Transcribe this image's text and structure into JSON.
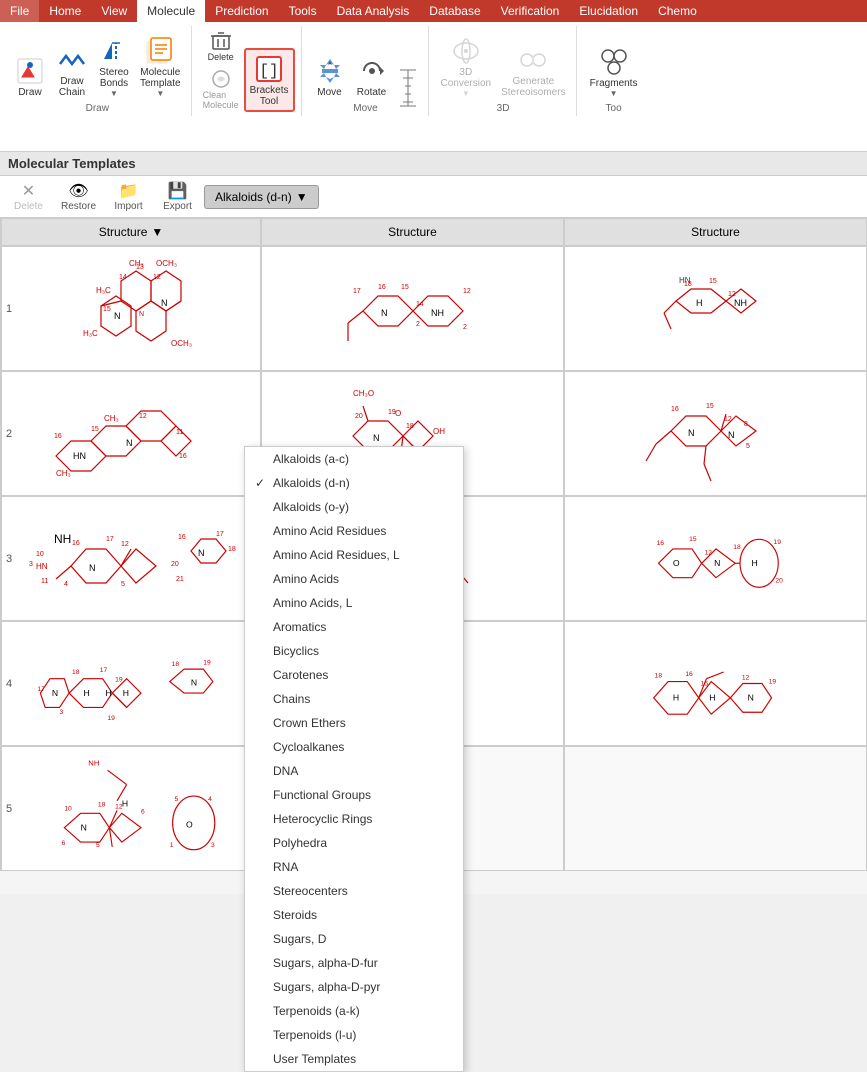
{
  "menuBar": {
    "items": [
      "File",
      "Home",
      "View",
      "Molecule",
      "Prediction",
      "Tools",
      "Data Analysis",
      "Database",
      "Verification",
      "Elucidation",
      "Chemo"
    ]
  },
  "ribbon": {
    "activeTab": "Molecule",
    "groups": [
      {
        "label": "Draw",
        "buttons": [
          {
            "id": "draw",
            "label": "Draw",
            "icon": "✏️"
          },
          {
            "id": "draw-chain",
            "label": "Draw\nChain",
            "icon": "chain"
          },
          {
            "id": "stereo-bonds",
            "label": "Stereo\nBonds",
            "icon": "stereo"
          },
          {
            "id": "molecule-template",
            "label": "Molecule\nTemplate",
            "icon": "📋"
          }
        ]
      },
      {
        "label": "",
        "buttons": [
          {
            "id": "delete",
            "label": "Delete",
            "icon": "delete"
          },
          {
            "id": "clean-molecule",
            "label": "Clean\nMolecule",
            "icon": "clean"
          },
          {
            "id": "brackets",
            "label": "Brackets\nTool",
            "icon": "brackets",
            "highlighted": true
          }
        ]
      },
      {
        "label": "Move",
        "buttons": [
          {
            "id": "move",
            "label": "Move",
            "icon": "move"
          },
          {
            "id": "rotate",
            "label": "Rotate",
            "icon": "rotate"
          },
          {
            "id": "scale",
            "label": "",
            "icon": "scale"
          }
        ]
      },
      {
        "label": "3D",
        "buttons": [
          {
            "id": "3d-conversion",
            "label": "3D\nConversion",
            "icon": "3d",
            "disabled": true
          },
          {
            "id": "generate-stereoisomers",
            "label": "Generate\nStereoisomers",
            "icon": "stereoiso",
            "disabled": true
          }
        ]
      },
      {
        "label": "Too",
        "buttons": [
          {
            "id": "fragments",
            "label": "Fragments",
            "icon": "fragments"
          }
        ]
      }
    ]
  },
  "toolbar": {
    "title": "Molecular Templates"
  },
  "actionBar": {
    "buttons": [
      {
        "id": "delete-btn",
        "label": "Delete",
        "icon": "✕",
        "disabled": false
      },
      {
        "id": "restore-btn",
        "label": "Restore",
        "icon": "👁",
        "disabled": false
      },
      {
        "id": "import-btn",
        "label": "Import",
        "icon": "📁",
        "disabled": false
      },
      {
        "id": "export-btn",
        "label": "Export",
        "icon": "💾",
        "disabled": false
      }
    ],
    "dropdown": {
      "label": "Alkaloids (d-n)",
      "active": true
    }
  },
  "grid": {
    "headers": [
      "Structure",
      "Structure",
      "Structure"
    ],
    "rows": [
      1,
      2,
      3,
      4,
      5
    ]
  },
  "dropdown": {
    "items": [
      {
        "label": "Alkaloids (a-c)",
        "checked": false
      },
      {
        "label": "Alkaloids (d-n)",
        "checked": true
      },
      {
        "label": "Alkaloids (o-y)",
        "checked": false
      },
      {
        "label": "Amino Acid Residues",
        "checked": false
      },
      {
        "label": "Amino Acid Residues, L",
        "checked": false
      },
      {
        "label": "Amino Acids",
        "checked": false
      },
      {
        "label": "Amino Acids, L",
        "checked": false
      },
      {
        "label": "Aromatics",
        "checked": false
      },
      {
        "label": "Bicyclics",
        "checked": false
      },
      {
        "label": "Carotenes",
        "checked": false
      },
      {
        "label": "Chains",
        "checked": false
      },
      {
        "label": "Crown Ethers",
        "checked": false
      },
      {
        "label": "Cycloalkanes",
        "checked": false
      },
      {
        "label": "DNA",
        "checked": false
      },
      {
        "label": "Functional Groups",
        "checked": false
      },
      {
        "label": "Heterocyclic Rings",
        "checked": false
      },
      {
        "label": "Polyhedra",
        "checked": false
      },
      {
        "label": "RNA",
        "checked": false
      },
      {
        "label": "Stereocenters",
        "checked": false
      },
      {
        "label": "Steroids",
        "checked": false
      },
      {
        "label": "Sugars, D",
        "checked": false
      },
      {
        "label": "Sugars, alpha-D-fur",
        "checked": false
      },
      {
        "label": "Sugars, alpha-D-pyr",
        "checked": false
      },
      {
        "label": "Terpenoids (a-k)",
        "checked": false
      },
      {
        "label": "Terpenoids (l-u)",
        "checked": false
      },
      {
        "label": "User Templates",
        "checked": false
      }
    ]
  }
}
